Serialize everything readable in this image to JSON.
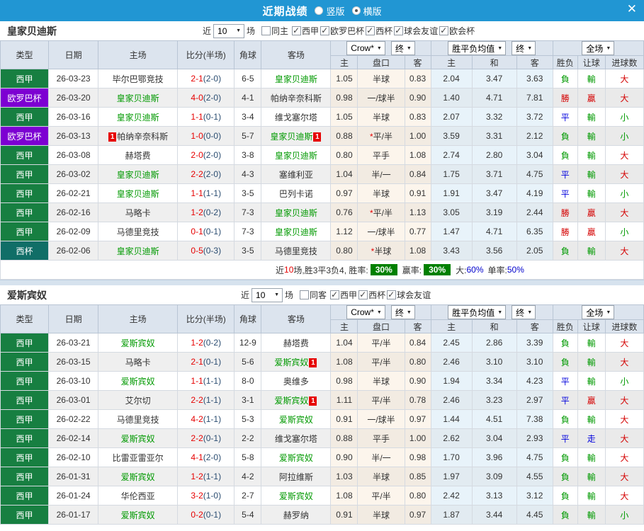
{
  "topbar": {
    "title": "近期战绩",
    "layout_options": [
      {
        "label": "竖版",
        "selected": false
      },
      {
        "label": "横版",
        "selected": true
      }
    ]
  },
  "icons": {
    "close": "✕",
    "dropdown_arrow": "▼"
  },
  "filter_labels": {
    "near": "近",
    "games_count": "10",
    "games": "场"
  },
  "table_header": {
    "type": "类型",
    "date": "日期",
    "home": "主场",
    "score": "比分(半场)",
    "corner": "角球",
    "away": "客场",
    "odds_source": "Crow*",
    "final1": "终",
    "avg_type": "胜平负均值",
    "final2": "终",
    "scope": "全场",
    "sub_home": "主",
    "sub_handicap": "盘口",
    "sub_away": "客",
    "sub_ehome": "主",
    "sub_draw": "和",
    "sub_eaway": "客",
    "sub_result": "胜负",
    "sub_letgoal": "让球",
    "sub_goals": "进球数"
  },
  "league_colors": {
    "西甲": "#177f41",
    "欧罗巴杯": "#7d00d2",
    "西杯": "#106e67"
  },
  "result_color_map": {
    "勝": "red",
    "贏": "red",
    "負": "green",
    "輸": "green",
    "平": "blue",
    "走": "blue",
    "大": "red",
    "小": "green"
  },
  "sections": [
    {
      "team": "皇家贝迪斯",
      "same_filter": {
        "label": "同主",
        "checked": false
      },
      "league_filters": [
        {
          "label": "西甲",
          "checked": true
        },
        {
          "label": "欧罗巴杯",
          "checked": true
        },
        {
          "label": "西杯",
          "checked": true
        },
        {
          "label": "球会友谊",
          "checked": true
        },
        {
          "label": "欧会杯",
          "checked": true
        }
      ],
      "rows": [
        {
          "lg": "西甲",
          "date": "26-03-23",
          "home": "毕尔巴鄂竞技",
          "hg": false,
          "hc": "",
          "ft": "2-1",
          "ht": "(2-0)",
          "cor": "6-5",
          "away": "皇家贝迪斯",
          "ag": true,
          "ac": "",
          "a1": "1.05",
          "star": false,
          "hcap": "半球",
          "a2": "0.83",
          "e1": "2.04",
          "e2": "3.47",
          "e3": "3.63",
          "r1": "負",
          "r2": "輸",
          "r3": "大"
        },
        {
          "lg": "欧罗巴杯",
          "date": "26-03-20",
          "home": "皇家贝迪斯",
          "hg": true,
          "hc": "",
          "ft": "4-0",
          "ht": "(2-0)",
          "cor": "4-1",
          "away": "帕纳辛奈科斯",
          "ag": false,
          "ac": "",
          "a1": "0.98",
          "star": false,
          "hcap": "一/球半",
          "a2": "0.90",
          "e1": "1.40",
          "e2": "4.71",
          "e3": "7.81",
          "r1": "勝",
          "r2": "贏",
          "r3": "大"
        },
        {
          "lg": "西甲",
          "date": "26-03-16",
          "home": "皇家贝迪斯",
          "hg": true,
          "hc": "",
          "ft": "1-1",
          "ht": "(0-1)",
          "cor": "3-4",
          "away": "维戈塞尔塔",
          "ag": false,
          "ac": "",
          "a1": "1.05",
          "star": false,
          "hcap": "半球",
          "a2": "0.83",
          "e1": "2.07",
          "e2": "3.32",
          "e3": "3.72",
          "r1": "平",
          "r2": "輸",
          "r3": "小"
        },
        {
          "lg": "欧罗巴杯",
          "date": "26-03-13",
          "home": "帕纳辛奈科斯",
          "hg": false,
          "hc": "1",
          "ft": "1-0",
          "ht": "(0-0)",
          "cor": "5-7",
          "away": "皇家贝迪斯",
          "ag": true,
          "ac": "1",
          "a1": "0.88",
          "star": true,
          "hcap": "平/半",
          "a2": "1.00",
          "e1": "3.59",
          "e2": "3.31",
          "e3": "2.12",
          "r1": "負",
          "r2": "輸",
          "r3": "小"
        },
        {
          "lg": "西甲",
          "date": "26-03-08",
          "home": "赫塔费",
          "hg": false,
          "hc": "",
          "ft": "2-0",
          "ht": "(2-0)",
          "cor": "3-8",
          "away": "皇家贝迪斯",
          "ag": true,
          "ac": "",
          "a1": "0.80",
          "star": false,
          "hcap": "平手",
          "a2": "1.08",
          "e1": "2.74",
          "e2": "2.80",
          "e3": "3.04",
          "r1": "負",
          "r2": "輸",
          "r3": "大"
        },
        {
          "lg": "西甲",
          "date": "26-03-02",
          "home": "皇家贝迪斯",
          "hg": true,
          "hc": "",
          "ft": "2-2",
          "ht": "(2-0)",
          "cor": "4-3",
          "away": "塞维利亚",
          "ag": false,
          "ac": "",
          "a1": "1.04",
          "star": false,
          "hcap": "半/一",
          "a2": "0.84",
          "e1": "1.75",
          "e2": "3.71",
          "e3": "4.75",
          "r1": "平",
          "r2": "輸",
          "r3": "大"
        },
        {
          "lg": "西甲",
          "date": "26-02-21",
          "home": "皇家贝迪斯",
          "hg": true,
          "hc": "",
          "ft": "1-1",
          "ht": "(1-1)",
          "cor": "3-5",
          "away": "巴列卡诺",
          "ag": false,
          "ac": "",
          "a1": "0.97",
          "star": false,
          "hcap": "半球",
          "a2": "0.91",
          "e1": "1.91",
          "e2": "3.47",
          "e3": "4.19",
          "r1": "平",
          "r2": "輸",
          "r3": "小"
        },
        {
          "lg": "西甲",
          "date": "26-02-16",
          "home": "马略卡",
          "hg": false,
          "hc": "",
          "ft": "1-2",
          "ht": "(0-2)",
          "cor": "7-3",
          "away": "皇家贝迪斯",
          "ag": true,
          "ac": "",
          "a1": "0.76",
          "star": true,
          "hcap": "平/半",
          "a2": "1.13",
          "e1": "3.05",
          "e2": "3.19",
          "e3": "2.44",
          "r1": "勝",
          "r2": "贏",
          "r3": "大"
        },
        {
          "lg": "西甲",
          "date": "26-02-09",
          "home": "马德里竞技",
          "hg": false,
          "hc": "",
          "ft": "0-1",
          "ht": "(0-1)",
          "cor": "7-3",
          "away": "皇家贝迪斯",
          "ag": true,
          "ac": "",
          "a1": "1.12",
          "star": false,
          "hcap": "一/球半",
          "a2": "0.77",
          "e1": "1.47",
          "e2": "4.71",
          "e3": "6.35",
          "r1": "勝",
          "r2": "贏",
          "r3": "小"
        },
        {
          "lg": "西杯",
          "date": "26-02-06",
          "home": "皇家贝迪斯",
          "hg": true,
          "hc": "",
          "ft": "0-5",
          "ht": "(0-3)",
          "cor": "3-5",
          "away": "马德里竞技",
          "ag": false,
          "ac": "",
          "a1": "0.80",
          "star": true,
          "hcap": "半球",
          "a2": "1.08",
          "e1": "3.43",
          "e2": "3.56",
          "e3": "2.05",
          "r1": "負",
          "r2": "輸",
          "r3": "大"
        }
      ],
      "summary": {
        "near_label": "近",
        "near_count": "10",
        "stats_text": "场,胜3平3负4, 胜率:",
        "win_rate": "30%",
        "profit_label": "赢率:",
        "profit_rate": "30%",
        "big_label": "大:",
        "big_rate": "60%",
        "odd_label": "单率:",
        "odd_rate": "50%"
      }
    },
    {
      "team": "爱斯宾奴",
      "same_filter": {
        "label": "同客",
        "checked": false
      },
      "league_filters": [
        {
          "label": "西甲",
          "checked": true
        },
        {
          "label": "西杯",
          "checked": true
        },
        {
          "label": "球会友谊",
          "checked": true
        }
      ],
      "rows": [
        {
          "lg": "西甲",
          "date": "26-03-21",
          "home": "爱斯宾奴",
          "hg": true,
          "hc": "",
          "ft": "1-2",
          "ht": "(0-2)",
          "cor": "12-9",
          "away": "赫塔费",
          "ag": false,
          "ac": "",
          "a1": "1.04",
          "star": false,
          "hcap": "平/半",
          "a2": "0.84",
          "e1": "2.45",
          "e2": "2.86",
          "e3": "3.39",
          "r1": "負",
          "r2": "輸",
          "r3": "大"
        },
        {
          "lg": "西甲",
          "date": "26-03-15",
          "home": "马略卡",
          "hg": false,
          "hc": "",
          "ft": "2-1",
          "ht": "(0-1)",
          "cor": "5-6",
          "away": "爱斯宾奴",
          "ag": true,
          "ac": "1",
          "a1": "1.08",
          "star": false,
          "hcap": "平/半",
          "a2": "0.80",
          "e1": "2.46",
          "e2": "3.10",
          "e3": "3.10",
          "r1": "負",
          "r2": "輸",
          "r3": "大"
        },
        {
          "lg": "西甲",
          "date": "26-03-10",
          "home": "爱斯宾奴",
          "hg": true,
          "hc": "",
          "ft": "1-1",
          "ht": "(1-1)",
          "cor": "8-0",
          "away": "奥维多",
          "ag": false,
          "ac": "",
          "a1": "0.98",
          "star": false,
          "hcap": "半球",
          "a2": "0.90",
          "e1": "1.94",
          "e2": "3.34",
          "e3": "4.23",
          "r1": "平",
          "r2": "輸",
          "r3": "小"
        },
        {
          "lg": "西甲",
          "date": "26-03-01",
          "home": "艾尔切",
          "hg": false,
          "hc": "",
          "ft": "2-2",
          "ht": "(1-1)",
          "cor": "3-1",
          "away": "爱斯宾奴",
          "ag": true,
          "ac": "1",
          "a1": "1.11",
          "star": false,
          "hcap": "平/半",
          "a2": "0.78",
          "e1": "2.46",
          "e2": "3.23",
          "e3": "2.97",
          "r1": "平",
          "r2": "贏",
          "r3": "大"
        },
        {
          "lg": "西甲",
          "date": "26-02-22",
          "home": "马德里竞技",
          "hg": false,
          "hc": "",
          "ft": "4-2",
          "ht": "(1-1)",
          "cor": "5-3",
          "away": "爱斯宾奴",
          "ag": true,
          "ac": "",
          "a1": "0.91",
          "star": false,
          "hcap": "一/球半",
          "a2": "0.97",
          "e1": "1.44",
          "e2": "4.51",
          "e3": "7.38",
          "r1": "負",
          "r2": "輸",
          "r3": "大"
        },
        {
          "lg": "西甲",
          "date": "26-02-14",
          "home": "爱斯宾奴",
          "hg": true,
          "hc": "",
          "ft": "2-2",
          "ht": "(0-1)",
          "cor": "2-2",
          "away": "维戈塞尔塔",
          "ag": false,
          "ac": "",
          "a1": "0.88",
          "star": false,
          "hcap": "平手",
          "a2": "1.00",
          "e1": "2.62",
          "e2": "3.04",
          "e3": "2.93",
          "r1": "平",
          "r2": "走",
          "r3": "大"
        },
        {
          "lg": "西甲",
          "date": "26-02-10",
          "home": "比雷亚雷亚尔",
          "hg": false,
          "hc": "",
          "ft": "4-1",
          "ht": "(2-0)",
          "cor": "5-8",
          "away": "爱斯宾奴",
          "ag": true,
          "ac": "",
          "a1": "0.90",
          "star": false,
          "hcap": "半/一",
          "a2": "0.98",
          "e1": "1.70",
          "e2": "3.96",
          "e3": "4.75",
          "r1": "負",
          "r2": "輸",
          "r3": "大"
        },
        {
          "lg": "西甲",
          "date": "26-01-31",
          "home": "爱斯宾奴",
          "hg": true,
          "hc": "",
          "ft": "1-2",
          "ht": "(1-1)",
          "cor": "4-2",
          "away": "阿拉维斯",
          "ag": false,
          "ac": "",
          "a1": "1.03",
          "star": false,
          "hcap": "半球",
          "a2": "0.85",
          "e1": "1.97",
          "e2": "3.09",
          "e3": "4.55",
          "r1": "負",
          "r2": "輸",
          "r3": "大"
        },
        {
          "lg": "西甲",
          "date": "26-01-24",
          "home": "华伦西亚",
          "hg": false,
          "hc": "",
          "ft": "3-2",
          "ht": "(1-0)",
          "cor": "2-7",
          "away": "爱斯宾奴",
          "ag": true,
          "ac": "",
          "a1": "1.08",
          "star": false,
          "hcap": "平/半",
          "a2": "0.80",
          "e1": "2.42",
          "e2": "3.13",
          "e3": "3.12",
          "r1": "負",
          "r2": "輸",
          "r3": "大"
        },
        {
          "lg": "西甲",
          "date": "26-01-17",
          "home": "爱斯宾奴",
          "hg": true,
          "hc": "",
          "ft": "0-2",
          "ht": "(0-1)",
          "cor": "5-4",
          "away": "赫罗纳",
          "ag": false,
          "ac": "",
          "a1": "0.91",
          "star": false,
          "hcap": "半球",
          "a2": "0.97",
          "e1": "1.87",
          "e2": "3.44",
          "e3": "4.45",
          "r1": "負",
          "r2": "輸",
          "r3": "小"
        }
      ],
      "summary": null
    }
  ]
}
